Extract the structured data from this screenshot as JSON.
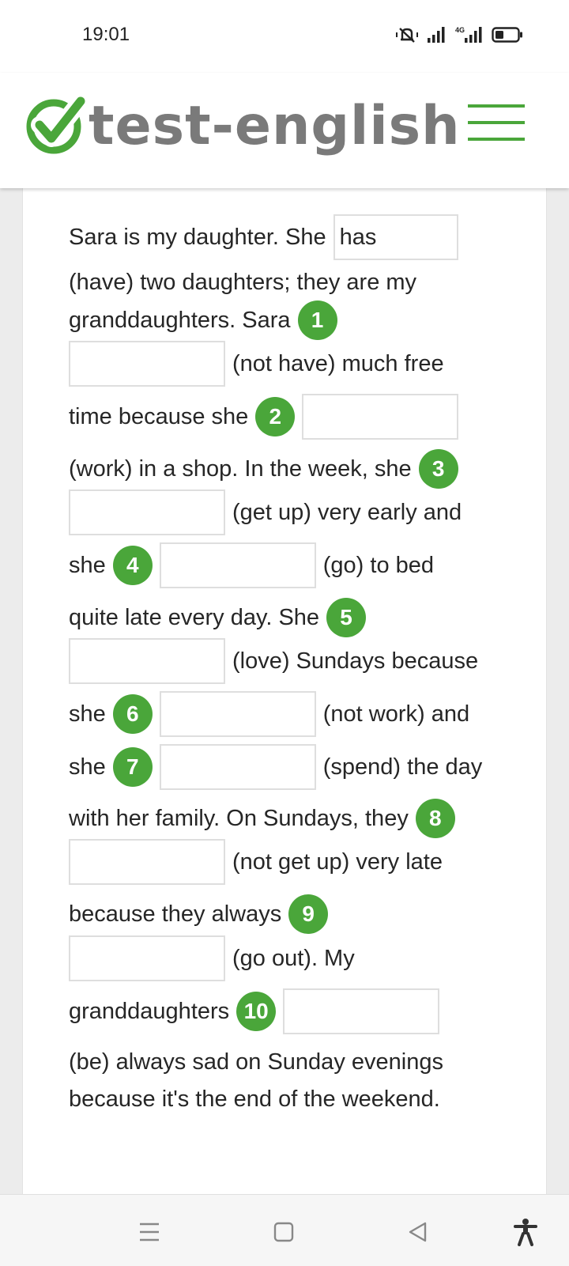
{
  "status_bar": {
    "time": "19:01",
    "network": "4G"
  },
  "header": {
    "logo_text": "test-english",
    "brand_color": "#4aa63a"
  },
  "exercise": {
    "l1_a": "Sara is my daughter. She",
    "l1_answer": "has",
    "l2": "(have) two daughters; they are my",
    "l3": "granddaughters. Sara",
    "l4": "(not have) much free",
    "l5": "time because she",
    "l6": "(work) in a shop. In the week, she",
    "l7": "(get up) very early and",
    "l8_a": "she",
    "l8_b": "(go) to bed",
    "l9": "quite late every day. She",
    "l10": "(love) Sundays because",
    "l11_a": "she",
    "l11_b": "(not work) and",
    "l12_a": "she",
    "l12_b": "(spend) the day",
    "l13": "with her family. On Sundays, they",
    "l14": "(not get up) very late",
    "l15": "because they always",
    "l16": "(go out). My",
    "l17": "granddaughters",
    "l18": "(be) always sad on Sunday evenings",
    "l19": "because it's the end of the weekend.",
    "numbers": [
      "1",
      "2",
      "3",
      "4",
      "5",
      "6",
      "7",
      "8",
      "9",
      "10"
    ]
  }
}
